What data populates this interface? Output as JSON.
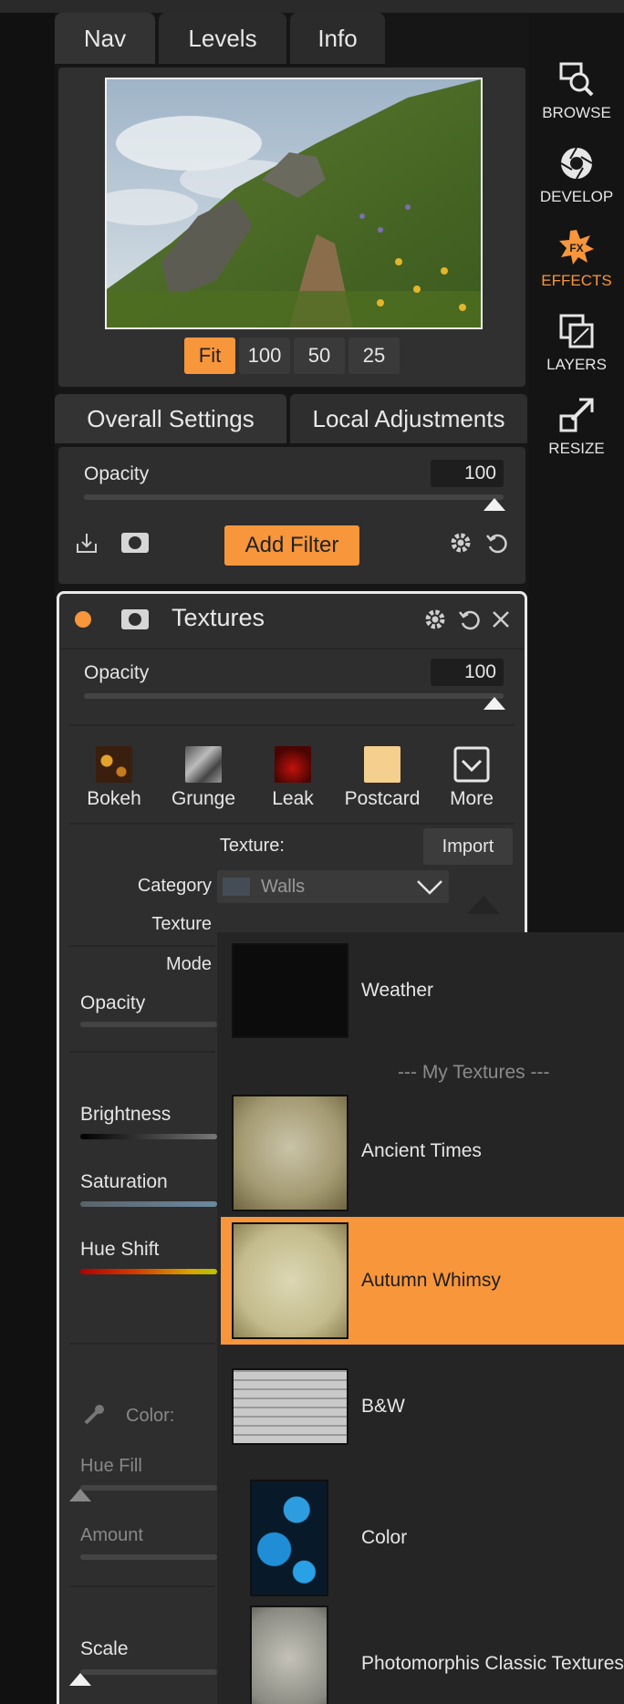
{
  "tabs": [
    "Nav",
    "Levels",
    "Info"
  ],
  "zoom": {
    "options": [
      "Fit",
      "100",
      "50",
      "25"
    ],
    "selected": "Fit"
  },
  "sidebar": {
    "items": [
      {
        "label": "BROWSE",
        "icon": "browse-icon"
      },
      {
        "label": "DEVELOP",
        "icon": "develop-icon"
      },
      {
        "label": "EFFECTS",
        "icon": "fx-icon",
        "active": true
      },
      {
        "label": "LAYERS",
        "icon": "layers-icon"
      },
      {
        "label": "RESIZE",
        "icon": "resize-icon"
      }
    ]
  },
  "settings_tabs": [
    "Overall Settings",
    "Local Adjustments"
  ],
  "overall": {
    "opacity_label": "Opacity",
    "opacity_value": "100",
    "add_filter_label": "Add Filter"
  },
  "textures_panel": {
    "title": "Textures",
    "opacity_label": "Opacity",
    "opacity_value": "100",
    "presets": [
      "Bokeh",
      "Grunge",
      "Leak",
      "Postcard",
      "More"
    ],
    "texture_label": "Texture:",
    "import_label": "Import",
    "category_label": "Category",
    "category_value": "Walls",
    "texture_row_label": "Texture",
    "mode_label": "Mode",
    "opacity2_label": "Opacity",
    "brightness_label": "Brightness",
    "saturation_label": "Saturation",
    "hue_shift_label": "Hue Shift",
    "color_label": "Color:",
    "hue_fill_label": "Hue Fill",
    "amount_label": "Amount",
    "scale_label": "Scale"
  },
  "dropdown": {
    "items": [
      "Weather",
      "--- My Textures ---",
      "Ancient Times",
      "Autumn Whimsy",
      "B&W",
      "Color",
      "Photomorphis Classic Textures"
    ],
    "selected": "Autumn Whimsy"
  },
  "colors": {
    "accent": "#f7963b",
    "panel": "#2e2e2e",
    "background": "#161616"
  }
}
